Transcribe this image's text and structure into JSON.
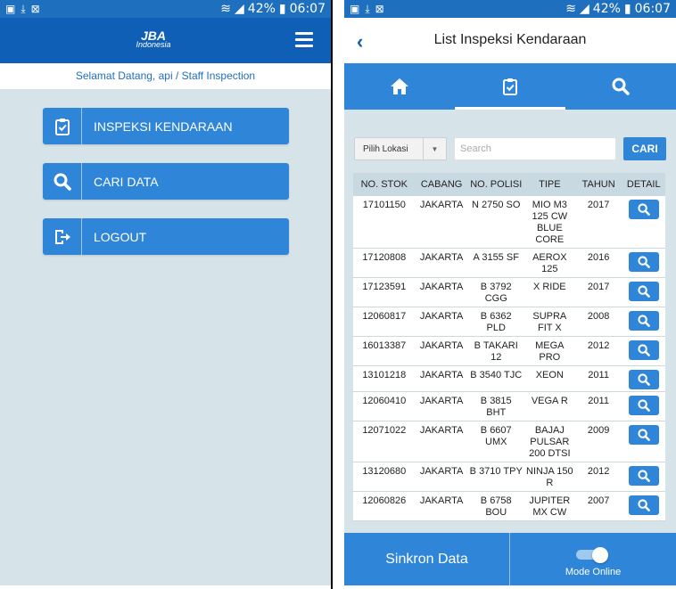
{
  "status_bar": {
    "left_icons": [
      "image-icon",
      "download-icon",
      "x-box-icon"
    ],
    "battery": "42%",
    "time": "06:07"
  },
  "left_screen": {
    "logo_main": "JBA",
    "logo_sub": "Indonesia",
    "welcome": "Selamat Datang, api / Staff Inspection",
    "menu": [
      {
        "label": "INSPEKSI KENDARAAN",
        "icon": "clipboard-check-icon"
      },
      {
        "label": "CARI DATA",
        "icon": "search-icon"
      },
      {
        "label": "LOGOUT",
        "icon": "logout-icon"
      }
    ]
  },
  "right_screen": {
    "title": "List Inspeksi Kendaraan",
    "tabs": [
      {
        "icon": "home-icon"
      },
      {
        "icon": "clipboard-check-icon",
        "active": true
      },
      {
        "icon": "search-icon"
      }
    ],
    "filter": {
      "location_select": "Pilih Lokasi",
      "search_placeholder": "Search",
      "search_button": "CARI"
    },
    "table": {
      "headers": [
        "NO. STOK",
        "CABANG",
        "NO. POLISI",
        "TIPE",
        "TAHUN",
        "DETAIL"
      ],
      "rows": [
        {
          "stok": "17101150",
          "cabang": "JAKARTA",
          "polisi": "N 2750 SO",
          "tipe": "MIO M3 125 CW BLUE CORE",
          "tahun": "2017"
        },
        {
          "stok": "17120808",
          "cabang": "JAKARTA",
          "polisi": "A 3155 SF",
          "tipe": "AEROX 125",
          "tahun": "2016"
        },
        {
          "stok": "17123591",
          "cabang": "JAKARTA",
          "polisi": "B 3792 CGG",
          "tipe": "X RIDE",
          "tahun": "2017"
        },
        {
          "stok": "12060817",
          "cabang": "JAKARTA",
          "polisi": "B 6362 PLD",
          "tipe": "SUPRA FIT X",
          "tahun": "2008"
        },
        {
          "stok": "16013387",
          "cabang": "JAKARTA",
          "polisi": "B TAKARI 12",
          "tipe": "MEGA PRO",
          "tahun": "2012"
        },
        {
          "stok": "13101218",
          "cabang": "JAKARTA",
          "polisi": "B 3540 TJC",
          "tipe": "XEON",
          "tahun": "2011"
        },
        {
          "stok": "12060410",
          "cabang": "JAKARTA",
          "polisi": "B 3815 BHT",
          "tipe": "VEGA R",
          "tahun": "2011"
        },
        {
          "stok": "12071022",
          "cabang": "JAKARTA",
          "polisi": "B 6607 UMX",
          "tipe": "BAJAJ PULSAR 200 DTSI",
          "tahun": "2009"
        },
        {
          "stok": "13120680",
          "cabang": "JAKARTA",
          "polisi": "B 3710 TPY",
          "tipe": "NINJA 150 R",
          "tahun": "2012"
        },
        {
          "stok": "12060826",
          "cabang": "JAKARTA",
          "polisi": "B 6758 BOU",
          "tipe": "JUPITER MX CW",
          "tahun": "2007"
        }
      ]
    },
    "bottom": {
      "sync_label": "Sinkron Data",
      "mode_label": "Mode Online",
      "mode_on": true
    }
  }
}
